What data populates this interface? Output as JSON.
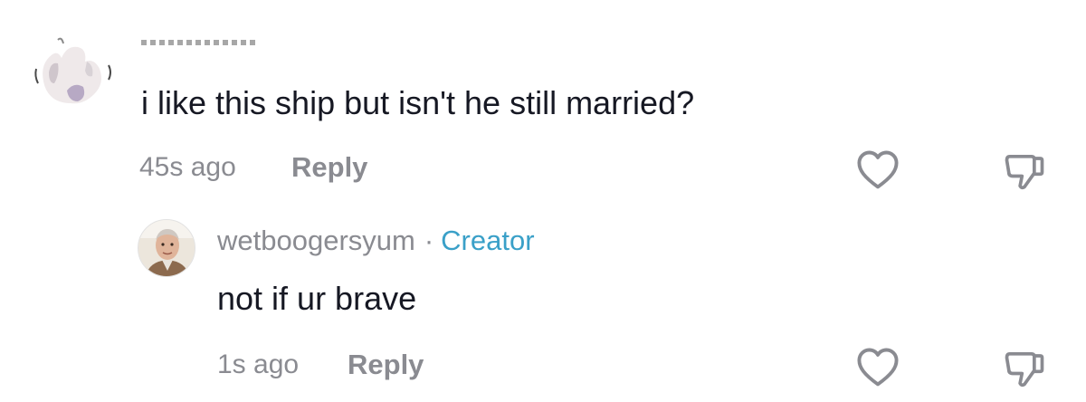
{
  "comment": {
    "username": "",
    "text": "i like this ship but isn't he still married?",
    "time": "45s ago",
    "reply_label": "Reply"
  },
  "reply": {
    "username": "wetboogersyum",
    "separator": "·",
    "badge": "Creator",
    "text": "not if ur brave",
    "time": "1s ago",
    "reply_label": "Reply"
  },
  "icons": {
    "like": "heart-outline-icon",
    "dislike": "thumbs-down-outline-icon"
  },
  "colors": {
    "text": "#161823",
    "muted": "#8a8b91",
    "creator_badge": "#3aa0c8",
    "icon": "#8a8b91"
  }
}
